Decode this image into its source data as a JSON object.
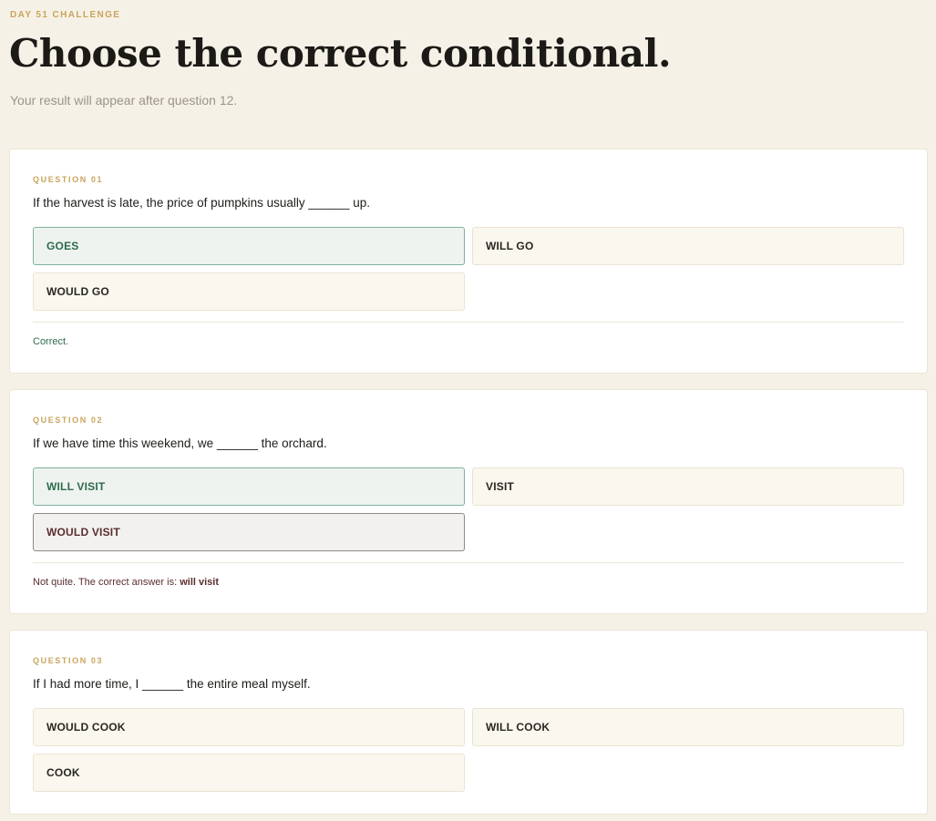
{
  "header": {
    "eyebrow": "DAY 51 CHALLENGE",
    "title": "Choose the correct conditional.",
    "subtitle": "Your result will appear after question 12."
  },
  "questions": [
    {
      "label": "QUESTION 01",
      "text": "If the harvest is late, the price of pumpkins usually ______ up.",
      "options": [
        "GOES",
        "WILL GO",
        "WOULD GO"
      ],
      "feedback": "Correct."
    },
    {
      "label": "QUESTION 02",
      "text": "If we have time this weekend, we ______ the orchard.",
      "options": [
        "WILL VISIT",
        "VISIT",
        "WOULD VISIT"
      ],
      "feedback_prefix": "Not quite. The correct answer is: ",
      "feedback_answer": "will visit"
    },
    {
      "label": "QUESTION 03",
      "text": "If I had more time, I ______ the entire meal myself.",
      "options": [
        "WOULD COOK",
        "WILL COOK",
        "COOK"
      ]
    }
  ],
  "colors": {
    "background": "#f6f1e6",
    "accent": "#c9a45c",
    "correct": "#2f6b4c",
    "incorrect": "#5a2e2e"
  }
}
